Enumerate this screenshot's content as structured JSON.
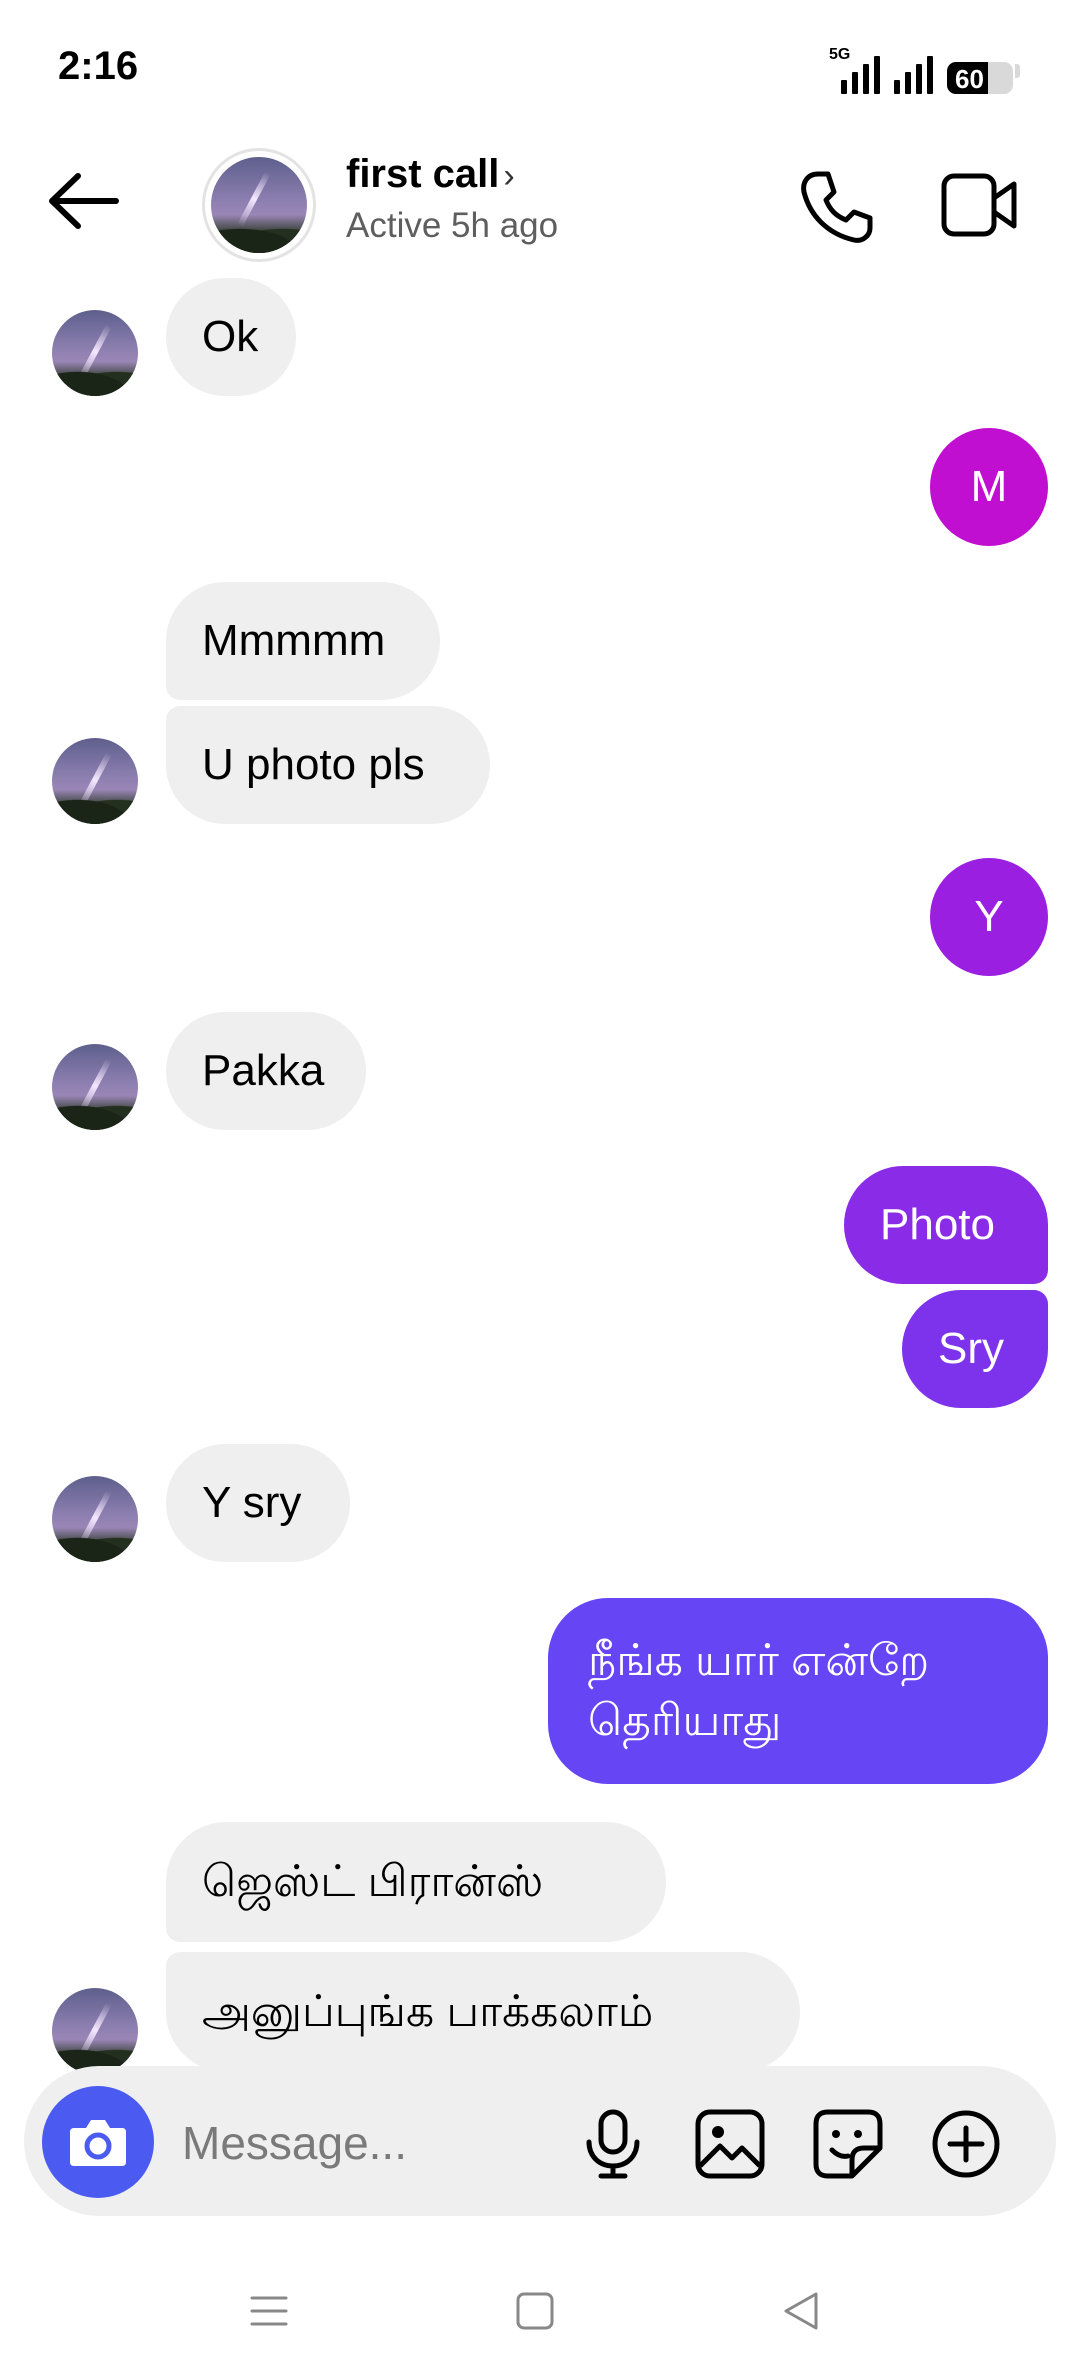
{
  "status_bar": {
    "time": "2:16",
    "network": "5G",
    "battery": "60"
  },
  "header": {
    "contact_name": "first call",
    "chevron": "›",
    "activity": "Active 5h ago",
    "icons": {
      "back": "arrow-left",
      "call": "phone",
      "video": "video-camera"
    }
  },
  "messages": [
    {
      "side": "in",
      "text": "Ok"
    },
    {
      "side": "out",
      "text": "M",
      "color": "#c10fd1"
    },
    {
      "side": "in",
      "text": "Mmmmm"
    },
    {
      "side": "in",
      "text": "U photo pls"
    },
    {
      "side": "out",
      "text": "Y",
      "color": "#9b1fe0"
    },
    {
      "side": "in",
      "text": "Pakka"
    },
    {
      "side": "out",
      "text": "Photo",
      "color": "#8a2be8"
    },
    {
      "side": "out",
      "text": "Sry",
      "color": "#7d33ec"
    },
    {
      "side": "in",
      "text": "Y sry"
    },
    {
      "side": "out",
      "text": "நீங்க யார் என்றே தெரியாது",
      "color": "#6645f5"
    },
    {
      "side": "in",
      "text": "ஜெஸ்ட் பிரான்ஸ்"
    },
    {
      "side": "in",
      "text": "அனுப்புங்க பாக்கலாம்"
    }
  ],
  "composer": {
    "placeholder": "Message...",
    "icons": [
      "camera",
      "microphone",
      "gallery",
      "sticker",
      "plus-circle"
    ],
    "camera_color": "#4b5bf1"
  },
  "nav_bar": {
    "icons": [
      "menu",
      "home",
      "back"
    ]
  }
}
